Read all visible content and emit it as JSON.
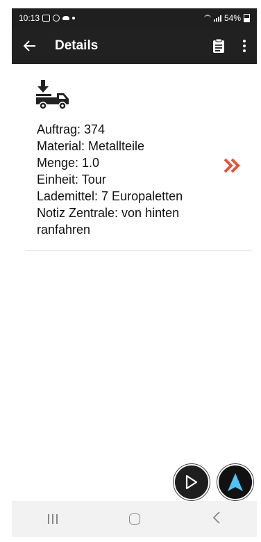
{
  "status_bar": {
    "time": "10:13",
    "battery": "54%"
  },
  "app_bar": {
    "title": "Details"
  },
  "order": {
    "lines": [
      "Auftrag: 374",
      "Material: Metallteile",
      "Menge: 1.0",
      "Einheit: Tour",
      "Lademittel: 7 Europaletten",
      "Notiz Zentrale: von hinten ranfahren"
    ]
  },
  "colors": {
    "app_bar_bg": "#212121",
    "chevron": "#e5533b",
    "nav_fab_arrow": "#4fc3f7"
  },
  "icons": {
    "back": "arrow-left-icon",
    "clipboard": "clipboard-icon",
    "more": "more-vert-icon",
    "truck": "truck-unload-icon",
    "open": "double-chevron-right-icon",
    "play": "play-icon",
    "navigate": "navigation-arrow-icon"
  }
}
